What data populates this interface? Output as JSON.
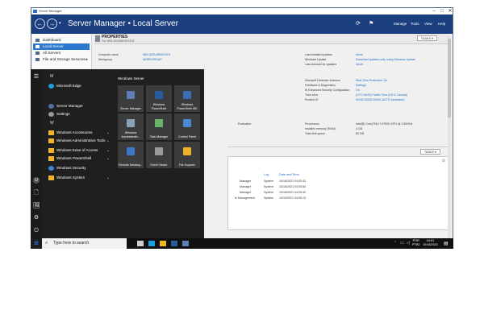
{
  "window": {
    "title": "Server Manager",
    "controls": [
      "–",
      "□",
      "✕"
    ],
    "breadcrumb": "Server Manager • Local Server",
    "menus": [
      "Manage",
      "Tools",
      "View",
      "Help"
    ],
    "icons": [
      "refresh-icon",
      "notifications-flag-icon"
    ]
  },
  "sidebar": {
    "items": [
      {
        "label": "Dashboard",
        "selected": false
      },
      {
        "label": "Local Server",
        "selected": true
      },
      {
        "label": "All Servers",
        "selected": false
      },
      {
        "label": "File and Storage Services",
        "selected": false
      }
    ],
    "chevron": "▸"
  },
  "properties": {
    "title": "PROPERTIES",
    "subtitle": "For WIN-3ZSU6R0EV2H1",
    "tasks_label": "TASKS ▾",
    "left": [
      {
        "key": "Computer name",
        "value": "WIN-3ZSU6R0EV2H1"
      },
      {
        "key": "Workgroup",
        "value": "WORKGROUP"
      }
    ],
    "right_top": [
      {
        "key": "Last installed updates",
        "value": "Never"
      },
      {
        "key": "Windows Update",
        "value": "Download updates only, using Windows Update"
      },
      {
        "key": "Last checked for updates",
        "value": "Never"
      }
    ],
    "right_mid": [
      {
        "key": "Microsoft Defender Antivirus",
        "value": "Real-Time Protection: On"
      },
      {
        "key": "Feedback & Diagnostics",
        "value": "Settings"
      },
      {
        "key": "IE Enhanced Security Configuration",
        "value": "On"
      },
      {
        "key": "Time zone",
        "value": "(UTC-08:00) Pacific Time (US & Canada)"
      },
      {
        "key": "Product ID",
        "value": "00430-30000-00001-AA772 (activated)"
      }
    ],
    "right_hw": [
      {
        "key": "Processors",
        "value": "Intel(R) Core(TM) i7-9750H CPU @ 2.60GHz"
      },
      {
        "key": "Installed memory (RAM)",
        "value": "4 GB"
      },
      {
        "key": "Total disk space",
        "value": "80 GB"
      }
    ],
    "partial_left_label": "Evaluation"
  },
  "events": {
    "tasks_label": "TASKS ▾",
    "columns": [
      "Log",
      "Date and Time"
    ],
    "rows": [
      {
        "source": "Manager",
        "log": "System",
        "datetime": "10/16/2021 04:02:43"
      },
      {
        "source": "Manager",
        "log": "System",
        "datetime": "10/16/2021 04:05:50"
      },
      {
        "source": "Manager",
        "log": "System",
        "datetime": "10/16/2021 04:05:40"
      },
      {
        "source": "le Management",
        "log": "System",
        "datetime": "10/16/2021 04:05:13"
      }
    ]
  },
  "start_menu": {
    "letters": [
      "M",
      "W"
    ],
    "apps": [
      {
        "label": "Microsoft Edge",
        "icon": "edge-icon",
        "color": "#1aa0e0",
        "folder": false
      },
      {
        "label": "Server Manager",
        "icon": "server-manager-icon",
        "color": "#4f6fa6",
        "folder": false
      },
      {
        "label": "Settings",
        "icon": "settings-gear-icon",
        "color": "#9a9a9a",
        "folder": false
      },
      {
        "label": "Windows Accessories",
        "icon": "folder-icon",
        "color": "#f0b429",
        "folder": true
      },
      {
        "label": "Windows Administrative Tools",
        "icon": "folder-icon",
        "color": "#f0b429",
        "folder": true
      },
      {
        "label": "Windows Ease of Access",
        "icon": "folder-icon",
        "color": "#f0b429",
        "folder": true
      },
      {
        "label": "Windows PowerShell",
        "icon": "folder-icon",
        "color": "#f0b429",
        "folder": true
      },
      {
        "label": "Windows Security",
        "icon": "shield-icon",
        "color": "#3f86d9",
        "folder": false
      },
      {
        "label": "Windows System",
        "icon": "folder-icon",
        "color": "#f0b429",
        "folder": true
      }
    ],
    "tile_group": "Windows Server",
    "tiles": [
      {
        "label": "Server Manager",
        "icon": "server-manager-icon",
        "color": "#5d7db3"
      },
      {
        "label": "Windows PowerShell",
        "icon": "powershell-icon",
        "color": "#2a5b9b"
      },
      {
        "label": "Windows PowerShell ISE",
        "icon": "powershell-ise-icon",
        "color": "#3a6fb5"
      },
      {
        "label": "Windows Administrativ...",
        "icon": "admin-tools-icon",
        "color": "#8aa1bc"
      },
      {
        "label": "Task Manager",
        "icon": "task-manager-icon",
        "color": "#6bb36b"
      },
      {
        "label": "Control Panel",
        "icon": "control-panel-icon",
        "color": "#4a87d6"
      },
      {
        "label": "Remote Desktop...",
        "icon": "remote-desktop-icon",
        "color": "#3c78c8"
      },
      {
        "label": "Event Viewer",
        "icon": "event-viewer-icon",
        "color": "#9a9a9a"
      },
      {
        "label": "File Explorer",
        "icon": "file-explorer-icon",
        "color": "#f0b429"
      }
    ],
    "rail": [
      "☰",
      "U",
      "🗋",
      "🖼",
      "⚙",
      "⏻"
    ]
  },
  "taskbar": {
    "start_glyph": "⊞",
    "search_placeholder": "Type here to search",
    "search_glyph": "⌕",
    "apps": [
      {
        "icon": "task-view-icon",
        "color": "#cfcfcf"
      },
      {
        "icon": "edge-icon",
        "color": "#1aa0e0"
      },
      {
        "icon": "file-explorer-icon",
        "color": "#f0b429"
      },
      {
        "icon": "powershell-icon",
        "color": "#2a5b9b"
      },
      {
        "icon": "server-manager-icon",
        "color": "#5d7db3"
      }
    ],
    "lang": "POR",
    "lang_sub": "PTB2",
    "time": "04:51",
    "date": "10/16/2021"
  }
}
